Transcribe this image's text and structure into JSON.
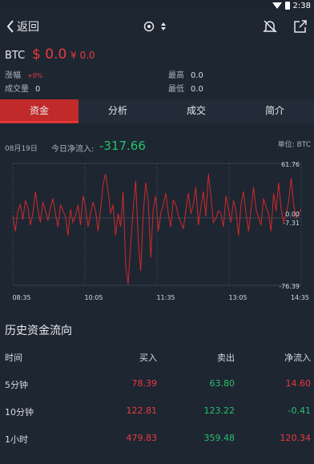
{
  "status": {
    "time": "2:38"
  },
  "header": {
    "back_label": "返回"
  },
  "coin": {
    "symbol": "BTC",
    "price_usd": "$ 0.0",
    "price_cny": "¥ 0.0",
    "change_label": "涨幅",
    "change_value": "+0%",
    "high_label": "最高",
    "high_value": "0.0",
    "volume_label": "成交量",
    "volume_value": "0",
    "low_label": "最低",
    "low_value": "0.0"
  },
  "tabs": [
    {
      "label": "资金",
      "active": true
    },
    {
      "label": "分析",
      "active": false
    },
    {
      "label": "成交",
      "active": false
    },
    {
      "label": "简介",
      "active": false
    }
  ],
  "chart_info": {
    "date": "08月19日",
    "inflow_label": "今日净流入:",
    "inflow_value": "-317.66",
    "unit": "单位: BTC"
  },
  "chart_data": {
    "type": "line",
    "title": "",
    "xlabel": "",
    "ylabel": "",
    "ylim": [
      -76.39,
      61.76
    ],
    "y_tick_labels": [
      "61.76",
      "0.00",
      "-7.31",
      "-76.39"
    ],
    "x_tick_labels": [
      "08:35",
      "10:05",
      "11:35",
      "13:05",
      "14:35"
    ],
    "colors": {
      "line": "#d02a2a"
    },
    "series": [
      {
        "values": [
          3,
          -15,
          8,
          15,
          -2,
          20,
          12,
          -8,
          5,
          30,
          10,
          -5,
          18,
          8,
          -3,
          12,
          22,
          5,
          -10,
          15,
          8,
          2,
          -20,
          10,
          -5,
          3,
          15,
          -8,
          25,
          12,
          -10,
          5,
          18,
          8,
          -15,
          10,
          38,
          50,
          30,
          5,
          15,
          -20,
          5,
          -10,
          30,
          -55,
          -75,
          -30,
          10,
          42,
          -25,
          -60,
          5,
          40,
          20,
          -45,
          10,
          25,
          -15,
          5,
          15,
          28,
          5,
          -10,
          20,
          15,
          3,
          -5,
          -12,
          8,
          28,
          5,
          15,
          35,
          -8,
          12,
          30,
          2,
          50,
          25,
          -5,
          0,
          8,
          5,
          -10,
          25,
          10,
          -5,
          20,
          8,
          -20,
          15,
          30,
          5,
          -15,
          10,
          35,
          10,
          0,
          -8,
          22,
          12,
          5,
          -15,
          28,
          8,
          40,
          10,
          -5,
          5,
          18,
          45,
          15,
          0,
          5,
          10
        ]
      }
    ]
  },
  "history": {
    "title": "历史资金流向",
    "columns": [
      "时间",
      "买入",
      "卖出",
      "净流入"
    ],
    "rows": [
      {
        "time": "5分钟",
        "buy": "78.39",
        "sell": "63.80",
        "net": "14.60"
      },
      {
        "time": "10分钟",
        "buy": "122.81",
        "sell": "123.22",
        "net": "-0.41"
      },
      {
        "time": "1小时",
        "buy": "479.83",
        "sell": "359.48",
        "net": "120.34"
      }
    ]
  }
}
